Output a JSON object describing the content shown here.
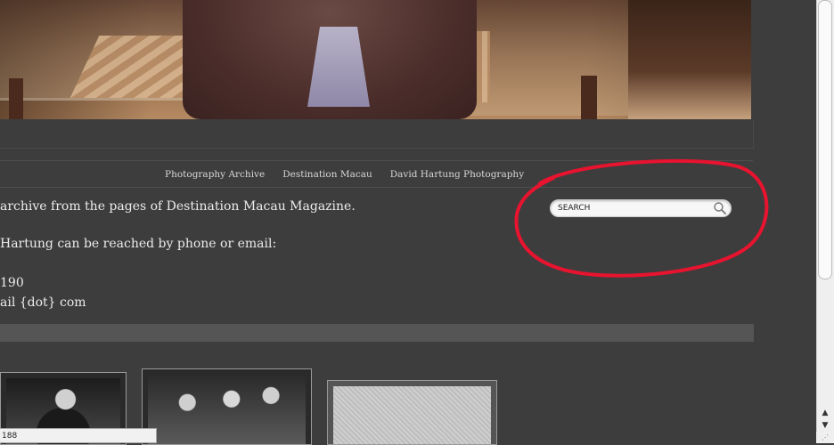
{
  "nav": {
    "items": [
      "Photography Archive",
      "Destination Macau",
      "David Hartung Photography"
    ]
  },
  "content": {
    "line1": "archive from the pages of Destination Macau Magazine.",
    "line2": "Hartung can be reached by phone or email:",
    "line3": "190",
    "line4": "ail {dot} com"
  },
  "search": {
    "placeholder": "SEARCH",
    "icon": "magnifier-icon"
  },
  "annotation": {
    "color": "#e8132f"
  },
  "statusbar": {
    "text": "188"
  },
  "scrollbar": {
    "up": "▲",
    "down": "▼"
  }
}
